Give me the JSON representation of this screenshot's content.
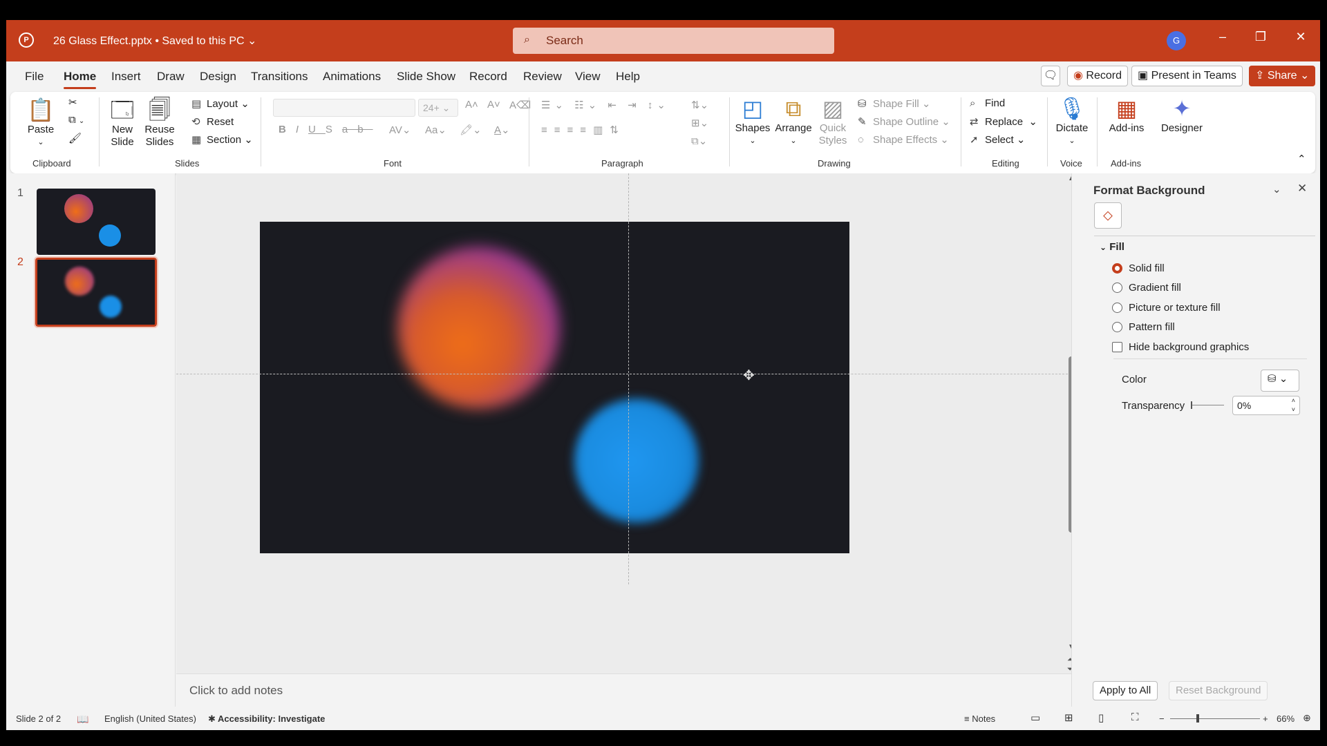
{
  "window": {
    "app_logo": "P",
    "doc_title": "26 Glass Effect.pptx • Saved to this PC",
    "search_placeholder": "Search",
    "user_initial": "G"
  },
  "menu": {
    "tabs": [
      "File",
      "Home",
      "Insert",
      "Draw",
      "Design",
      "Transitions",
      "Animations",
      "Slide Show",
      "Record",
      "Review",
      "View",
      "Help"
    ],
    "active_tab": "Home",
    "record_label": "Record",
    "present_teams_label": "Present in Teams",
    "share_label": "Share"
  },
  "ribbon": {
    "groups": [
      "Clipboard",
      "Slides",
      "Font",
      "Paragraph",
      "Drawing",
      "Editing",
      "Voice",
      "Add-ins"
    ],
    "paste": "Paste",
    "new_slide": "New Slide",
    "reuse_slides": "Reuse Slides",
    "layout": "Layout",
    "reset": "Reset",
    "section": "Section",
    "font_size": "24+",
    "shapes": "Shapes",
    "arrange": "Arrange",
    "quick_styles": "Quick Styles",
    "shape_fill": "Shape Fill",
    "shape_outline": "Shape Outline",
    "shape_effects": "Shape Effects",
    "find": "Find",
    "replace": "Replace",
    "select": "Select",
    "dictate": "Dictate",
    "addins": "Add-ins",
    "designer": "Designer"
  },
  "slides": {
    "numbers": [
      "1",
      "2"
    ],
    "selected": 2
  },
  "notes_placeholder": "Click to add notes",
  "format_panel": {
    "title": "Format Background",
    "section": "Fill",
    "options": [
      {
        "label": "Solid fill",
        "selected": true
      },
      {
        "label": "Gradient fill",
        "selected": false
      },
      {
        "label": "Picture or texture fill",
        "selected": false
      },
      {
        "label": "Pattern fill",
        "selected": false
      }
    ],
    "hide_bg_graphics": "Hide background graphics",
    "color_label": "Color",
    "transparency_label": "Transparency",
    "transparency_value": "0%",
    "apply_all": "Apply to All",
    "reset_bg": "Reset Background"
  },
  "status": {
    "slide_info": "Slide 2 of 2",
    "language": "English (United States)",
    "accessibility": "Accessibility: Investigate",
    "notes": "Notes",
    "zoom": "66%"
  },
  "colors": {
    "accent": "#c43e1c",
    "slide_bg": "#1a1b21",
    "orb_orange": "#ef6e17",
    "orb_purple": "#7b2d9a",
    "orb_blue": "#1f96f0"
  }
}
